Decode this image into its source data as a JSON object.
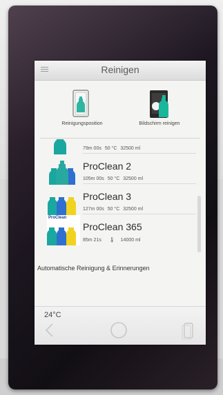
{
  "header": {
    "title": "Reinigen"
  },
  "actions": [
    {
      "label": "Reinigungsposition",
      "icon": "door-bottle-icon"
    },
    {
      "label": "Bildschirm reinigen",
      "icon": "screen-spray-icon"
    }
  ],
  "programs": [
    {
      "name": "",
      "time": "79m 00s",
      "temp": "50 °C",
      "volume": "32500 ml"
    },
    {
      "name": "ProClean 2",
      "time": "105m 00s",
      "temp": "50 °C",
      "volume": "32500 ml"
    },
    {
      "name": "ProClean 3",
      "time": "127m 00s",
      "temp": "50 °C",
      "volume": "32500 ml"
    },
    {
      "name": "ProClean 365",
      "time": "85m 21s",
      "temp": "",
      "volume": "14000 ml",
      "badge": "ProClean"
    }
  ],
  "auto_link": "Automatische Reinigung & Erinnerungen",
  "status": {
    "temperature": "24°C"
  },
  "nav": [
    "back-icon",
    "home-icon",
    "recent-icon"
  ],
  "colors": {
    "bottle_teal": "#1aa7a0",
    "bottle_blue": "#2f6fd0",
    "bottle_yellow": "#f1d21f",
    "bezel": "#1c1620"
  }
}
